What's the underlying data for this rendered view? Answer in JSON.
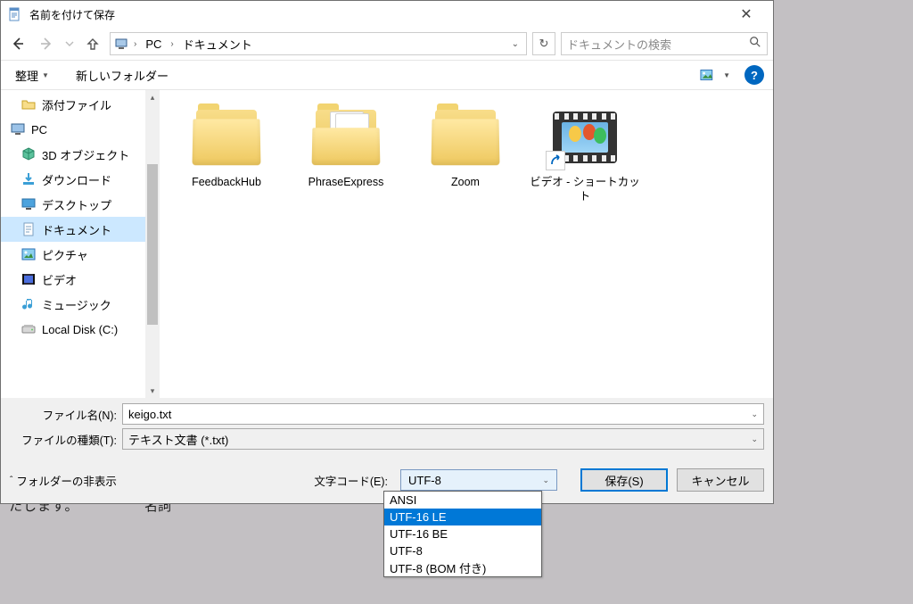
{
  "title": "名前を付けて保存",
  "nav": {
    "path": {
      "root": "PC",
      "current": "ドキュメント"
    },
    "search_placeholder": "ドキュメントの検索"
  },
  "toolbar": {
    "organize": "整理",
    "newfolder": "新しいフォルダー"
  },
  "tree": {
    "items": [
      {
        "label": "添付ファイル",
        "icon": "folder",
        "indent": 1
      },
      {
        "label": "PC",
        "icon": "pc",
        "indent": 0,
        "pc": true
      },
      {
        "label": "3D オブジェクト",
        "icon": "3d",
        "indent": 1
      },
      {
        "label": "ダウンロード",
        "icon": "download",
        "indent": 1
      },
      {
        "label": "デスクトップ",
        "icon": "desktop",
        "indent": 1
      },
      {
        "label": "ドキュメント",
        "icon": "document",
        "indent": 1,
        "selected": true
      },
      {
        "label": "ピクチャ",
        "icon": "pictures",
        "indent": 1
      },
      {
        "label": "ビデオ",
        "icon": "video",
        "indent": 1
      },
      {
        "label": "ミュージック",
        "icon": "music",
        "indent": 1
      },
      {
        "label": "Local Disk (C:)",
        "icon": "disk",
        "indent": 1
      }
    ]
  },
  "files": [
    {
      "label": "FeedbackHub",
      "type": "folder"
    },
    {
      "label": "PhraseExpress",
      "type": "folder-open"
    },
    {
      "label": "Zoom",
      "type": "folder"
    },
    {
      "label": "ビデオ - ショートカット",
      "type": "video-shortcut"
    }
  ],
  "fields": {
    "filename_label": "ファイル名(N):",
    "filename_value": "keigo.txt",
    "filetype_label": "ファイルの種類(T):",
    "filetype_value": "テキスト文書 (*.txt)"
  },
  "footer": {
    "hide_folders": "フォルダーの非表示",
    "encoding_label": "文字コード(E):",
    "encoding_value": "UTF-8",
    "encoding_options": [
      "ANSI",
      "UTF-16 LE",
      "UTF-16 BE",
      "UTF-8",
      "UTF-8 (BOM 付き)"
    ],
    "encoding_highlight_index": 1,
    "save": "保存(S)",
    "cancel": "キャンセル"
  },
  "background": {
    "text1": "たします。",
    "text2": "名詞"
  }
}
